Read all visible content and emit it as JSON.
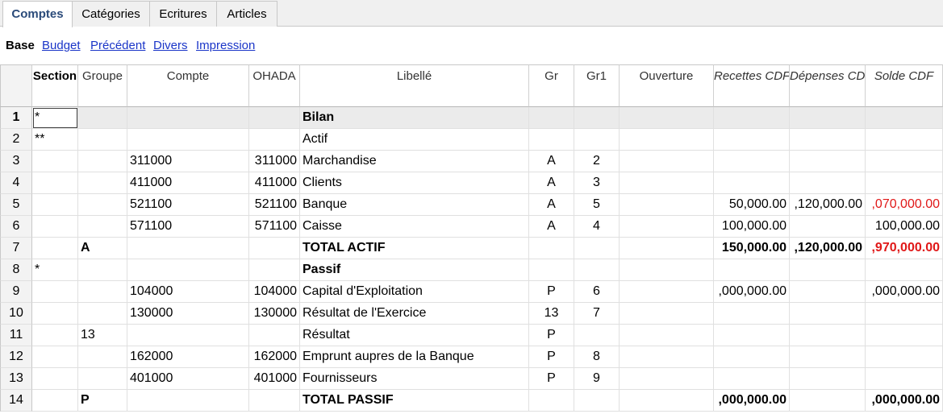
{
  "tabs": [
    {
      "label": "Comptes",
      "active": true
    },
    {
      "label": "Catégories",
      "active": false
    },
    {
      "label": "Ecritures",
      "active": false
    },
    {
      "label": "Articles",
      "active": false
    }
  ],
  "views": {
    "current": "Base",
    "links": [
      "Budget",
      "Précédent",
      "Divers",
      "Impression"
    ]
  },
  "columns": {
    "section": "Section",
    "groupe": "Groupe",
    "compte": "Compte",
    "ohada": "OHADA",
    "libelle": "Libellé",
    "gr": "Gr",
    "gr1": "Gr1",
    "ouverture": "Ouverture",
    "recettes": "Recettes CDF",
    "depenses": "Dépenses CDF",
    "solde": "Solde CDF"
  },
  "rows": [
    {
      "n": "1",
      "section": "*",
      "groupe": "",
      "compte": "",
      "ohada": "",
      "libelle": "Bilan",
      "gr": "",
      "gr1": "",
      "ouverture": "",
      "recettes": "",
      "depenses": "",
      "solde": "",
      "bold": true,
      "selected": true
    },
    {
      "n": "2",
      "section": "**",
      "groupe": "",
      "compte": "",
      "ohada": "",
      "libelle": "Actif",
      "gr": "",
      "gr1": "",
      "ouverture": "",
      "recettes": "",
      "depenses": "",
      "solde": ""
    },
    {
      "n": "3",
      "section": "",
      "groupe": "",
      "compte": "311000",
      "ohada": "311000",
      "libelle": "Marchandise",
      "gr": "A",
      "gr1": "2",
      "ouverture": "",
      "recettes": "",
      "depenses": "",
      "solde": ""
    },
    {
      "n": "4",
      "section": "",
      "groupe": "",
      "compte": "411000",
      "ohada": "411000",
      "libelle": "Clients",
      "gr": "A",
      "gr1": "3",
      "ouverture": "",
      "recettes": "",
      "depenses": "",
      "solde": ""
    },
    {
      "n": "5",
      "section": "",
      "groupe": "",
      "compte": "521100",
      "ohada": "521100",
      "libelle": "Banque",
      "gr": "A",
      "gr1": "5",
      "ouverture": "",
      "recettes": "50,000.00",
      "depenses": ",120,000.00",
      "solde": ",070,000.00",
      "solde_red": true
    },
    {
      "n": "6",
      "section": "",
      "groupe": "",
      "compte": "571100",
      "ohada": "571100",
      "libelle": "Caisse",
      "gr": "A",
      "gr1": "4",
      "ouverture": "",
      "recettes": "100,000.00",
      "depenses": "",
      "solde": "100,000.00"
    },
    {
      "n": "7",
      "section": "",
      "groupe": "A",
      "compte": "",
      "ohada": "",
      "libelle": "TOTAL ACTIF",
      "gr": "",
      "gr1": "",
      "ouverture": "",
      "recettes": "150,000.00",
      "depenses": ",120,000.00",
      "solde": ",970,000.00",
      "bold": true,
      "solde_red": true
    },
    {
      "n": "8",
      "section": "*",
      "groupe": "",
      "compte": "",
      "ohada": "",
      "libelle": "Passif",
      "gr": "",
      "gr1": "",
      "ouverture": "",
      "recettes": "",
      "depenses": "",
      "solde": "",
      "bold": true
    },
    {
      "n": "9",
      "section": "",
      "groupe": "",
      "compte": "104000",
      "ohada": "104000",
      "libelle": "Capital d'Exploitation",
      "gr": "P",
      "gr1": "6",
      "ouverture": "",
      "recettes": ",000,000.00",
      "depenses": "",
      "solde": ",000,000.00"
    },
    {
      "n": "10",
      "section": "",
      "groupe": "",
      "compte": "130000",
      "ohada": "130000",
      "libelle": "Résultat de l'Exercice",
      "gr": "13",
      "gr1": "7",
      "ouverture": "",
      "recettes": "",
      "depenses": "",
      "solde": ""
    },
    {
      "n": "11",
      "section": "",
      "groupe": "13",
      "compte": "",
      "ohada": "",
      "libelle": "Résultat",
      "gr": "P",
      "gr1": "",
      "ouverture": "",
      "recettes": "",
      "depenses": "",
      "solde": ""
    },
    {
      "n": "12",
      "section": "",
      "groupe": "",
      "compte": "162000",
      "ohada": "162000",
      "libelle": "Emprunt aupres de la Banque",
      "gr": "P",
      "gr1": "8",
      "ouverture": "",
      "recettes": "",
      "depenses": "",
      "solde": ""
    },
    {
      "n": "13",
      "section": "",
      "groupe": "",
      "compte": "401000",
      "ohada": "401000",
      "libelle": "Fournisseurs",
      "gr": "P",
      "gr1": "9",
      "ouverture": "",
      "recettes": "",
      "depenses": "",
      "solde": ""
    },
    {
      "n": "14",
      "section": "",
      "groupe": "P",
      "compte": "",
      "ohada": "",
      "libelle": "TOTAL PASSIF",
      "gr": "",
      "gr1": "",
      "ouverture": "",
      "recettes": ",000,000.00",
      "depenses": "",
      "solde": ",000,000.00",
      "bold": true
    }
  ],
  "colors": {
    "negative": "#e01818",
    "link": "#1a35c8",
    "active_tab_text": "#2b4b7a"
  }
}
